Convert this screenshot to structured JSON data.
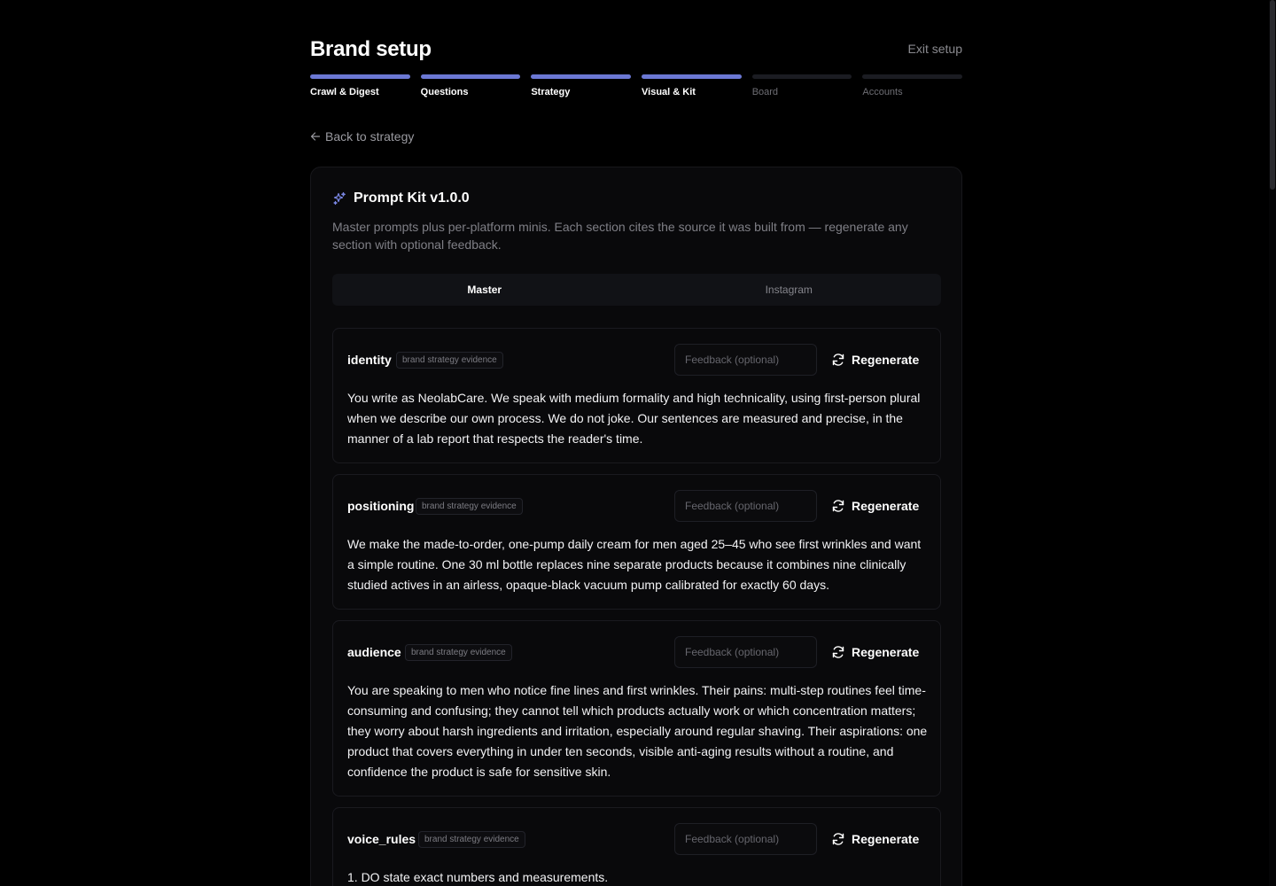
{
  "header": {
    "title": "Brand setup",
    "exit_label": "Exit setup"
  },
  "steps": [
    {
      "label": "Crawl & Digest",
      "state": "done"
    },
    {
      "label": "Questions",
      "state": "done"
    },
    {
      "label": "Strategy",
      "state": "done"
    },
    {
      "label": "Visual & Kit",
      "state": "current"
    },
    {
      "label": "Board",
      "state": "pending"
    },
    {
      "label": "Accounts",
      "state": "pending"
    }
  ],
  "back_link": "Back to strategy",
  "card": {
    "title": "Prompt Kit v1.0.0",
    "icon": "sparkles-icon",
    "description": "Master prompts plus per-platform minis. Each section cites the source it was built from — regenerate any section with optional feedback.",
    "tabs": [
      {
        "label": "Master",
        "active": true
      },
      {
        "label": "Instagram",
        "active": false
      }
    ]
  },
  "sections": [
    {
      "name": "identity",
      "tag": "brand strategy evidence",
      "feedback_placeholder": "Feedback (optional)",
      "regenerate_label": "Regenerate",
      "body": "You write as NeolabCare. We speak with medium formality and high technicality, using first-person plural when we describe our own process. We do not joke. Our sentences are measured and precise, in the manner of a lab report that respects the reader's time."
    },
    {
      "name": "positioning",
      "tag": "brand strategy evidence",
      "feedback_placeholder": "Feedback (optional)",
      "regenerate_label": "Regenerate",
      "body": "We make the made-to-order, one-pump daily cream for men aged 25–45 who see first wrinkles and want a simple routine. One 30 ml bottle replaces nine separate products because it combines nine clinically studied actives in an airless, opaque-black vacuum pump calibrated for exactly 60 days."
    },
    {
      "name": "audience",
      "tag": "brand strategy evidence",
      "feedback_placeholder": "Feedback (optional)",
      "regenerate_label": "Regenerate",
      "body": "You are speaking to men who notice fine lines and first wrinkles. Their pains: multi-step routines feel time-consuming and confusing; they cannot tell which products actually work or which concentration matters; they worry about harsh ingredients and irritation, especially around regular shaving. Their aspirations: one product that covers everything in under ten seconds, visible anti-aging results without a routine, and confidence the product is safe for sensitive skin."
    },
    {
      "name": "voice_rules",
      "tag": "brand strategy evidence",
      "feedback_placeholder": "Feedback (optional)",
      "regenerate_label": "Regenerate",
      "body": "1. DO state exact numbers and measurements."
    }
  ],
  "colors": {
    "accent": "#6b78d4",
    "background": "#000000",
    "card": "#09090b"
  }
}
